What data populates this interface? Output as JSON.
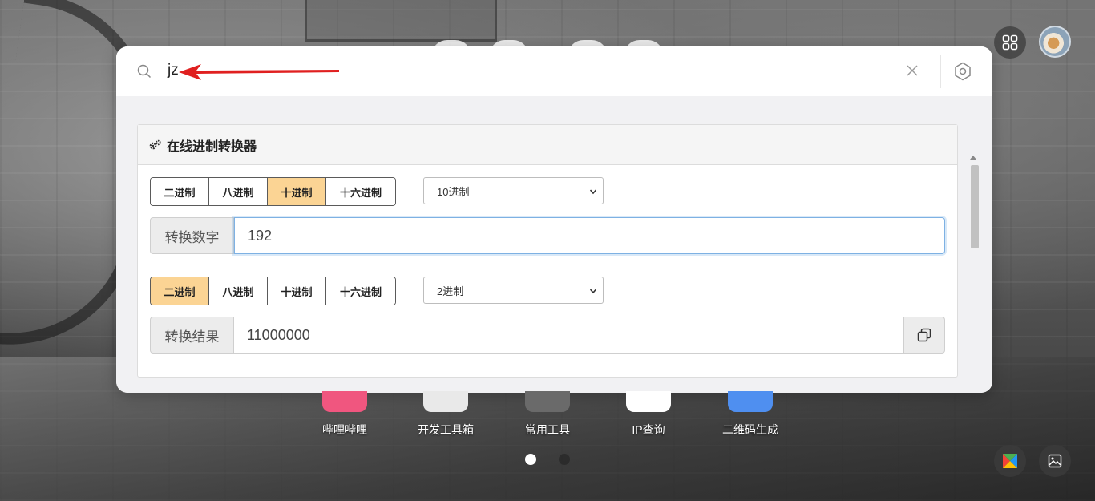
{
  "search": {
    "query": "jz"
  },
  "tool": {
    "title": "在线进制转换器",
    "input_bases": [
      "二进制",
      "八进制",
      "十进制",
      "十六进制"
    ],
    "input_active_index": 2,
    "input_select": "10进制",
    "input_label": "转换数字",
    "input_value": "192",
    "output_bases": [
      "二进制",
      "八进制",
      "十进制",
      "十六进制"
    ],
    "output_active_index": 0,
    "output_select": "2进制",
    "output_label": "转换结果",
    "output_value": "11000000"
  },
  "dock": [
    {
      "label": "哔哩哔哩",
      "color": "#f0567f"
    },
    {
      "label": "开发工具箱",
      "color": "#e9e9e9"
    },
    {
      "label": "常用工具",
      "color": "#6a6a6a"
    },
    {
      "label": "IP查询",
      "color": "#ffffff"
    },
    {
      "label": "二维码生成",
      "color": "#4f8ff0"
    }
  ],
  "colors": {
    "active_button": "#fbd494",
    "arrow": "#e02020",
    "focus_border": "#7eb1e3"
  },
  "icons": {
    "search": "search-icon",
    "clear": "close-icon",
    "settings": "hexagon-settings-icon",
    "apps": "grid-icon",
    "copy": "copy-icon",
    "gears": "gears-icon"
  }
}
